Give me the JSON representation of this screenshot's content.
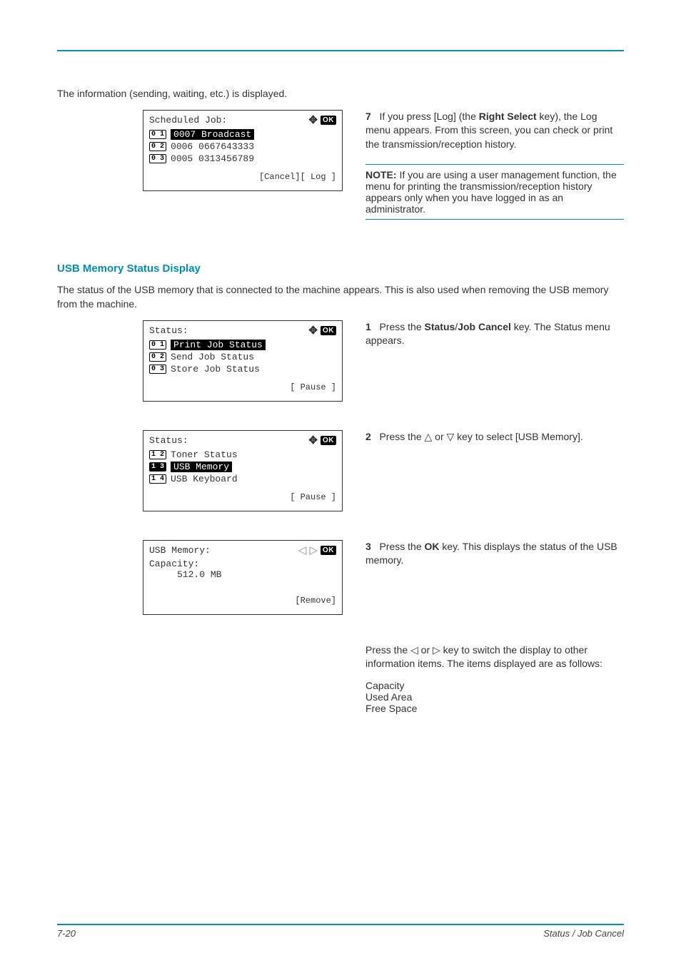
{
  "hr_present": true,
  "section1": {
    "intro": "The information (sending, waiting, etc.) is displayed.",
    "screen": {
      "title": "Scheduled Job:",
      "nav_ok": "OK",
      "rows": [
        {
          "num": "0 1",
          "highlighted": true,
          "text": "0007 Broadcast"
        },
        {
          "num": "0 2",
          "highlighted": false,
          "text": "0006 0667643333"
        },
        {
          "num": "0 3",
          "highlighted": false,
          "text": "0005 0313456789"
        }
      ],
      "softkeys": "[Cancel][ Log  ]"
    },
    "right": {
      "step_num": "7",
      "step_text_a": "If you press [Log] (the ",
      "step_key": "Right Select",
      "step_text_b": " key), the Log menu appears. From this screen, you can check or print the transmission/reception history.",
      "note_label": "NOTE:",
      "note_text": " If you are using a user management function, the menu for printing the transmission/reception history appears only when you have logged in as an administrator."
    }
  },
  "usb_heading": "USB Memory Status Display",
  "usb_intro": "The status of the USB memory that is connected to the machine appears. This is also used when removing the USB memory from the machine.",
  "step1": {
    "screen": {
      "title": "Status:",
      "nav_ok": "OK",
      "rows": [
        {
          "num": "0 1",
          "highlighted": true,
          "text": "Print Job Status"
        },
        {
          "num": "0 2",
          "highlighted": false,
          "text": "Send Job Status"
        },
        {
          "num": "0 3",
          "highlighted": false,
          "text": "Store Job Status"
        }
      ],
      "softkeys": "[ Pause ]"
    },
    "num": "1",
    "text_a": "Press the ",
    "key1": "Status",
    "sep": "/",
    "key2": "Job Cancel",
    "text_b": " key. The Status menu appears."
  },
  "step2": {
    "screen": {
      "title": "Status:",
      "nav_ok": "OK",
      "rows": [
        {
          "num": "1 2",
          "highlighted": false,
          "text": "Toner Status"
        },
        {
          "num": "1 3",
          "highlighted": true,
          "text": "USB Memory"
        },
        {
          "num": "1 4",
          "highlighted": false,
          "text": "USB Keyboard"
        }
      ],
      "softkeys": "[ Pause ]"
    },
    "num": "2",
    "text": "Press the △ or ▽ key to select [USB Memory]."
  },
  "step3": {
    "screen": {
      "title": "USB Memory:",
      "nav_ok": "OK",
      "line1": "Capacity:",
      "line2": "     512.0 MB",
      "softkeys": "[Remove]"
    },
    "num": "3",
    "text_a": "Press the ",
    "key": "OK",
    "text_b": " key. This displays the status of the USB memory."
  },
  "step4": {
    "text": "Press the ◁ or ▷ key to switch the display to other information items. The items displayed are as follows:",
    "items": [
      "Capacity",
      "Used Area",
      "Free Space"
    ]
  },
  "footer": {
    "page": "7-20",
    "label": "Status / Job Cancel"
  }
}
